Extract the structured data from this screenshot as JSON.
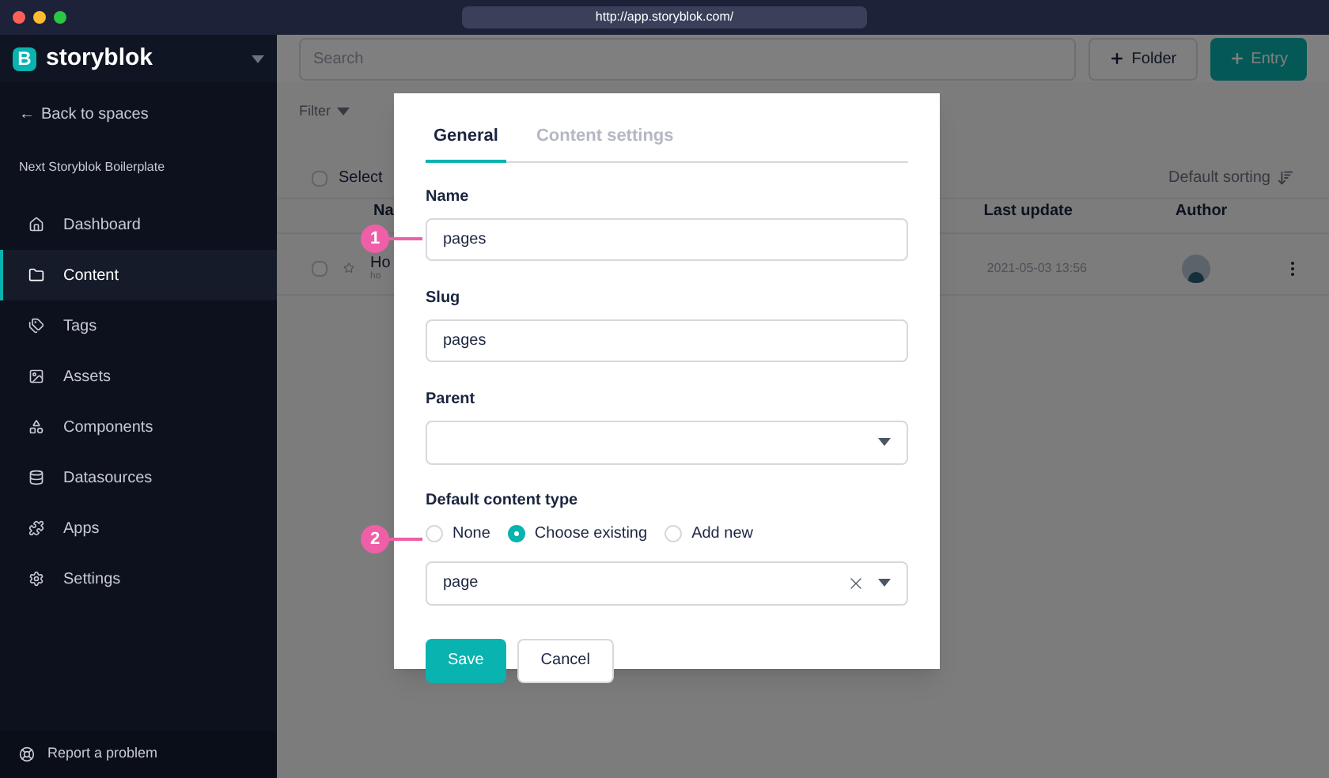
{
  "browser": {
    "url": "http://app.storyblok.com/"
  },
  "sidebar": {
    "logo_mark": "B",
    "logo": "storyblok",
    "back_arrow": "←",
    "back": "Back to spaces",
    "space": "Next Storyblok Boilerplate",
    "items": [
      {
        "label": "Dashboard",
        "selected": false
      },
      {
        "label": "Content",
        "selected": true
      },
      {
        "label": "Tags",
        "selected": false
      },
      {
        "label": "Assets",
        "selected": false
      },
      {
        "label": "Components",
        "selected": false
      },
      {
        "label": "Datasources",
        "selected": false
      },
      {
        "label": "Apps",
        "selected": false
      },
      {
        "label": "Settings",
        "selected": false
      }
    ],
    "footer": "Report a problem"
  },
  "toolbar": {
    "search_placeholder": "Search",
    "buttons": [
      {
        "label": "Folder",
        "kind": "secondary"
      },
      {
        "label": "Entry",
        "kind": "primary"
      }
    ]
  },
  "filter": "Filter",
  "list": {
    "select": "Select",
    "select_checked": false,
    "sorting": "Default sorting",
    "columns": [
      "Na",
      "Last update",
      "Author"
    ],
    "rows": [
      {
        "name": "Ho",
        "slug": "ho",
        "updated": "2021-05-03 13:56",
        "checked": false
      }
    ]
  },
  "modal": {
    "tabs": [
      {
        "label": "General",
        "selected": true
      },
      {
        "label": "Content settings",
        "selected": false
      }
    ],
    "name": {
      "label": "Name",
      "value": "pages"
    },
    "slug": {
      "label": "Slug",
      "value": "pages"
    },
    "parent": {
      "label": "Parent"
    },
    "content_type": {
      "label": "Default content type",
      "options": [
        {
          "label": "None",
          "selected": false
        },
        {
          "label": "Choose existing",
          "selected": true
        },
        {
          "label": "Add new",
          "selected": false
        }
      ],
      "value": "page"
    },
    "buttons": [
      {
        "label": "Save",
        "kind": "primary"
      },
      {
        "label": "Cancel",
        "kind": "secondary"
      }
    ]
  },
  "callouts": [
    "1",
    "2"
  ]
}
